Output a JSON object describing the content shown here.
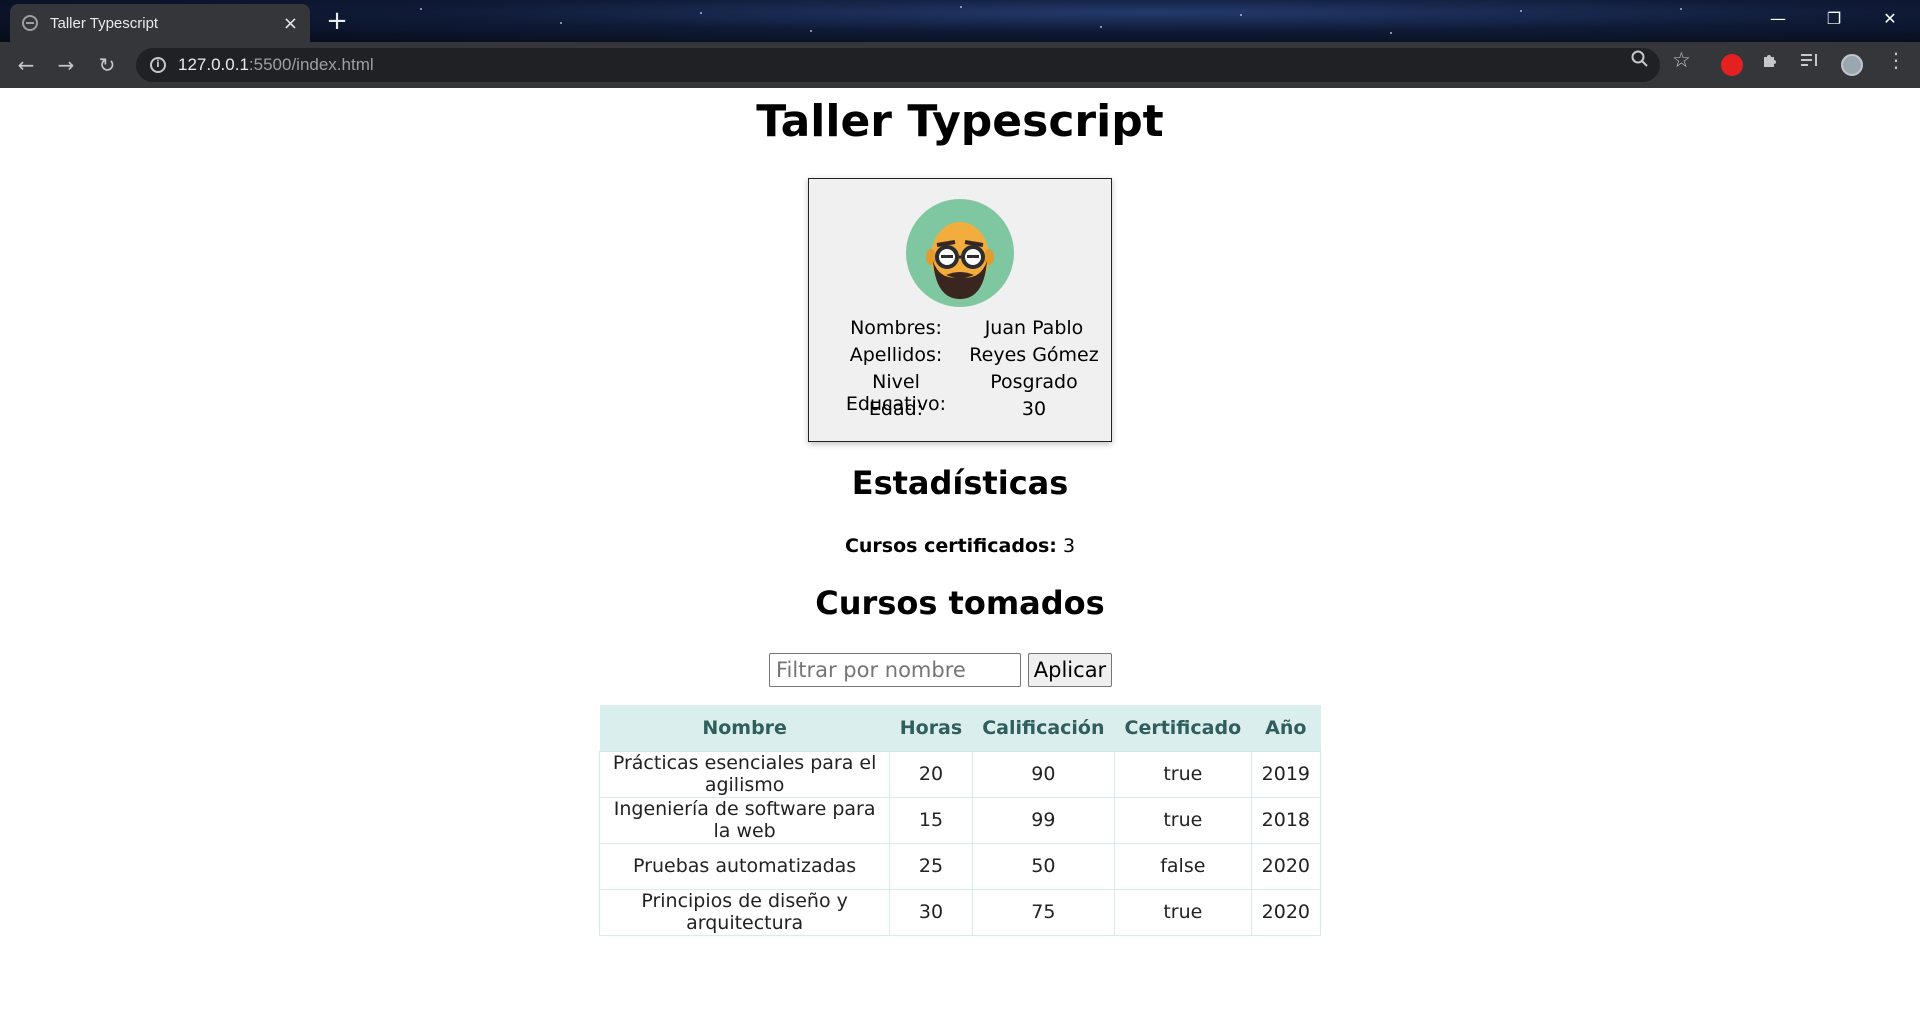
{
  "browser": {
    "tab_title": "Taller Typescript",
    "tab_close": "×",
    "new_tab": "+",
    "url_host": "127.0.0.1",
    "url_path": ":5500/index.html",
    "window_controls": {
      "minimize": "—",
      "restore": "❐",
      "close": "✕"
    },
    "nav": {
      "back": "←",
      "forward": "→",
      "reload": "↻"
    },
    "icons": {
      "zoom": "🔍",
      "bookmark": "☆",
      "menu": "⋮"
    },
    "accent": "#35363a"
  },
  "page": {
    "title": "Taller Typescript"
  },
  "profile": {
    "rows": [
      {
        "label": "Nombres:",
        "value": "Juan Pablo"
      },
      {
        "label": "Apellidos:",
        "value": "Reyes Gómez"
      },
      {
        "label": "Nivel Educativo:",
        "value": "Posgrado"
      },
      {
        "label": "Edad:",
        "value": "30"
      }
    ],
    "avatar_bg": "#7fc7a1"
  },
  "stats": {
    "title": "Estadísticas",
    "certified_label": "Cursos certificados:",
    "certified_value": "3"
  },
  "courses": {
    "title": "Cursos tomados",
    "filter_placeholder": "Filtrar por nombre",
    "apply_label": "Aplicar",
    "headers": [
      "Nombre",
      "Horas",
      "Calificación",
      "Certificado",
      "Año"
    ],
    "rows": [
      [
        "Prácticas esenciales para el agilismo",
        "20",
        "90",
        "true",
        "2019"
      ],
      [
        "Ingeniería de software para la web",
        "15",
        "99",
        "true",
        "2018"
      ],
      [
        "Pruebas automatizadas",
        "25",
        "50",
        "false",
        "2020"
      ],
      [
        "Principios de diseño y arquitectura",
        "30",
        "75",
        "true",
        "2020"
      ]
    ],
    "header_bg": "#daeeed",
    "header_color": "#2f5e5c"
  }
}
